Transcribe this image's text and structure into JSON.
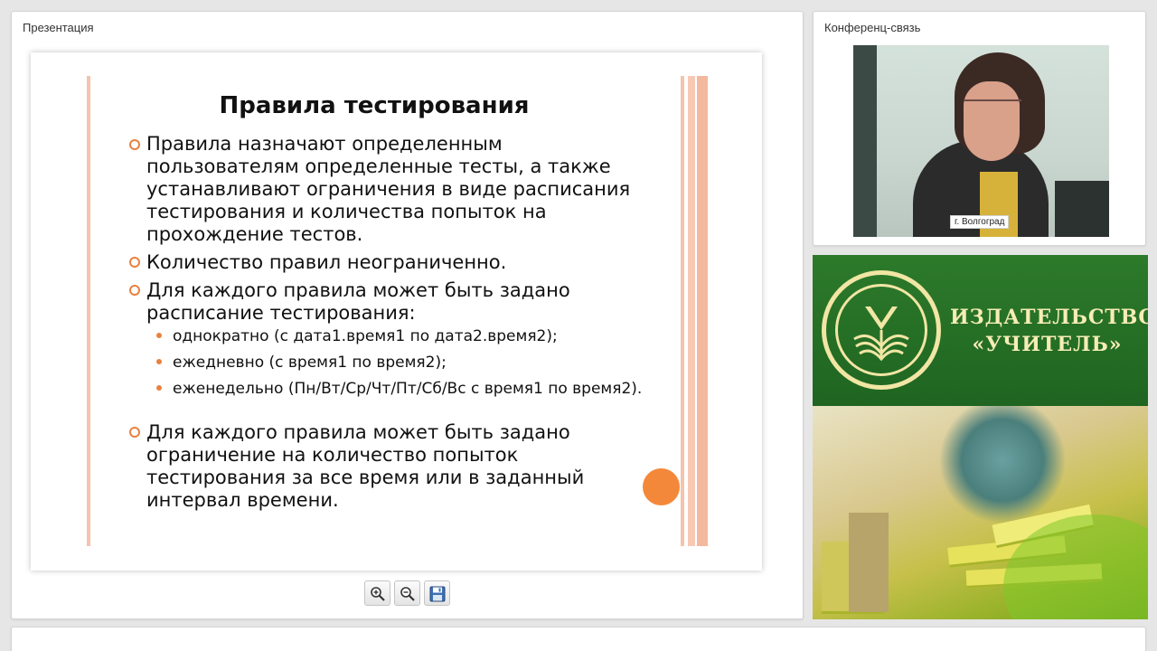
{
  "presentation": {
    "panel_title": "Презентация",
    "slide": {
      "title": "Правила тестирования",
      "bullets": [
        "Правила назначают определенным пользователям определенные тесты, а также устанавливают ограничения в виде расписания тестирования и количества попыток на прохождение тестов.",
        "Количество правил неограниченно.",
        "Для каждого правила может быть задано расписание тестирования:",
        "Для каждого правила может быть задано ограничение на количество попыток тестирования за все время или в заданный интервал времени."
      ],
      "sub_bullets": [
        "однократно (с дата1.время1 по дата2.время2);",
        "ежедневно (с время1 по время2);",
        "еженедельно (Пн/Вт/Ср/Чт/Пт/Сб/Вс с время1 по время2)."
      ]
    },
    "toolbar": {
      "zoom_in_icon": "zoom-in-icon",
      "zoom_out_icon": "zoom-out-icon",
      "save_icon": "floppy-disk-icon"
    }
  },
  "conference": {
    "panel_title": "Конференц-связь",
    "video_caption": "г. Волгоград"
  },
  "banner": {
    "line1": "ИЗДАТЕЛЬСТВО",
    "line2": "«УЧИТЕЛЬ»"
  },
  "colors": {
    "accent_orange": "#f4883a",
    "slide_stripe": "#f4c4ac",
    "banner_green": "#2d7a2b",
    "banner_text": "#f6edb5"
  }
}
